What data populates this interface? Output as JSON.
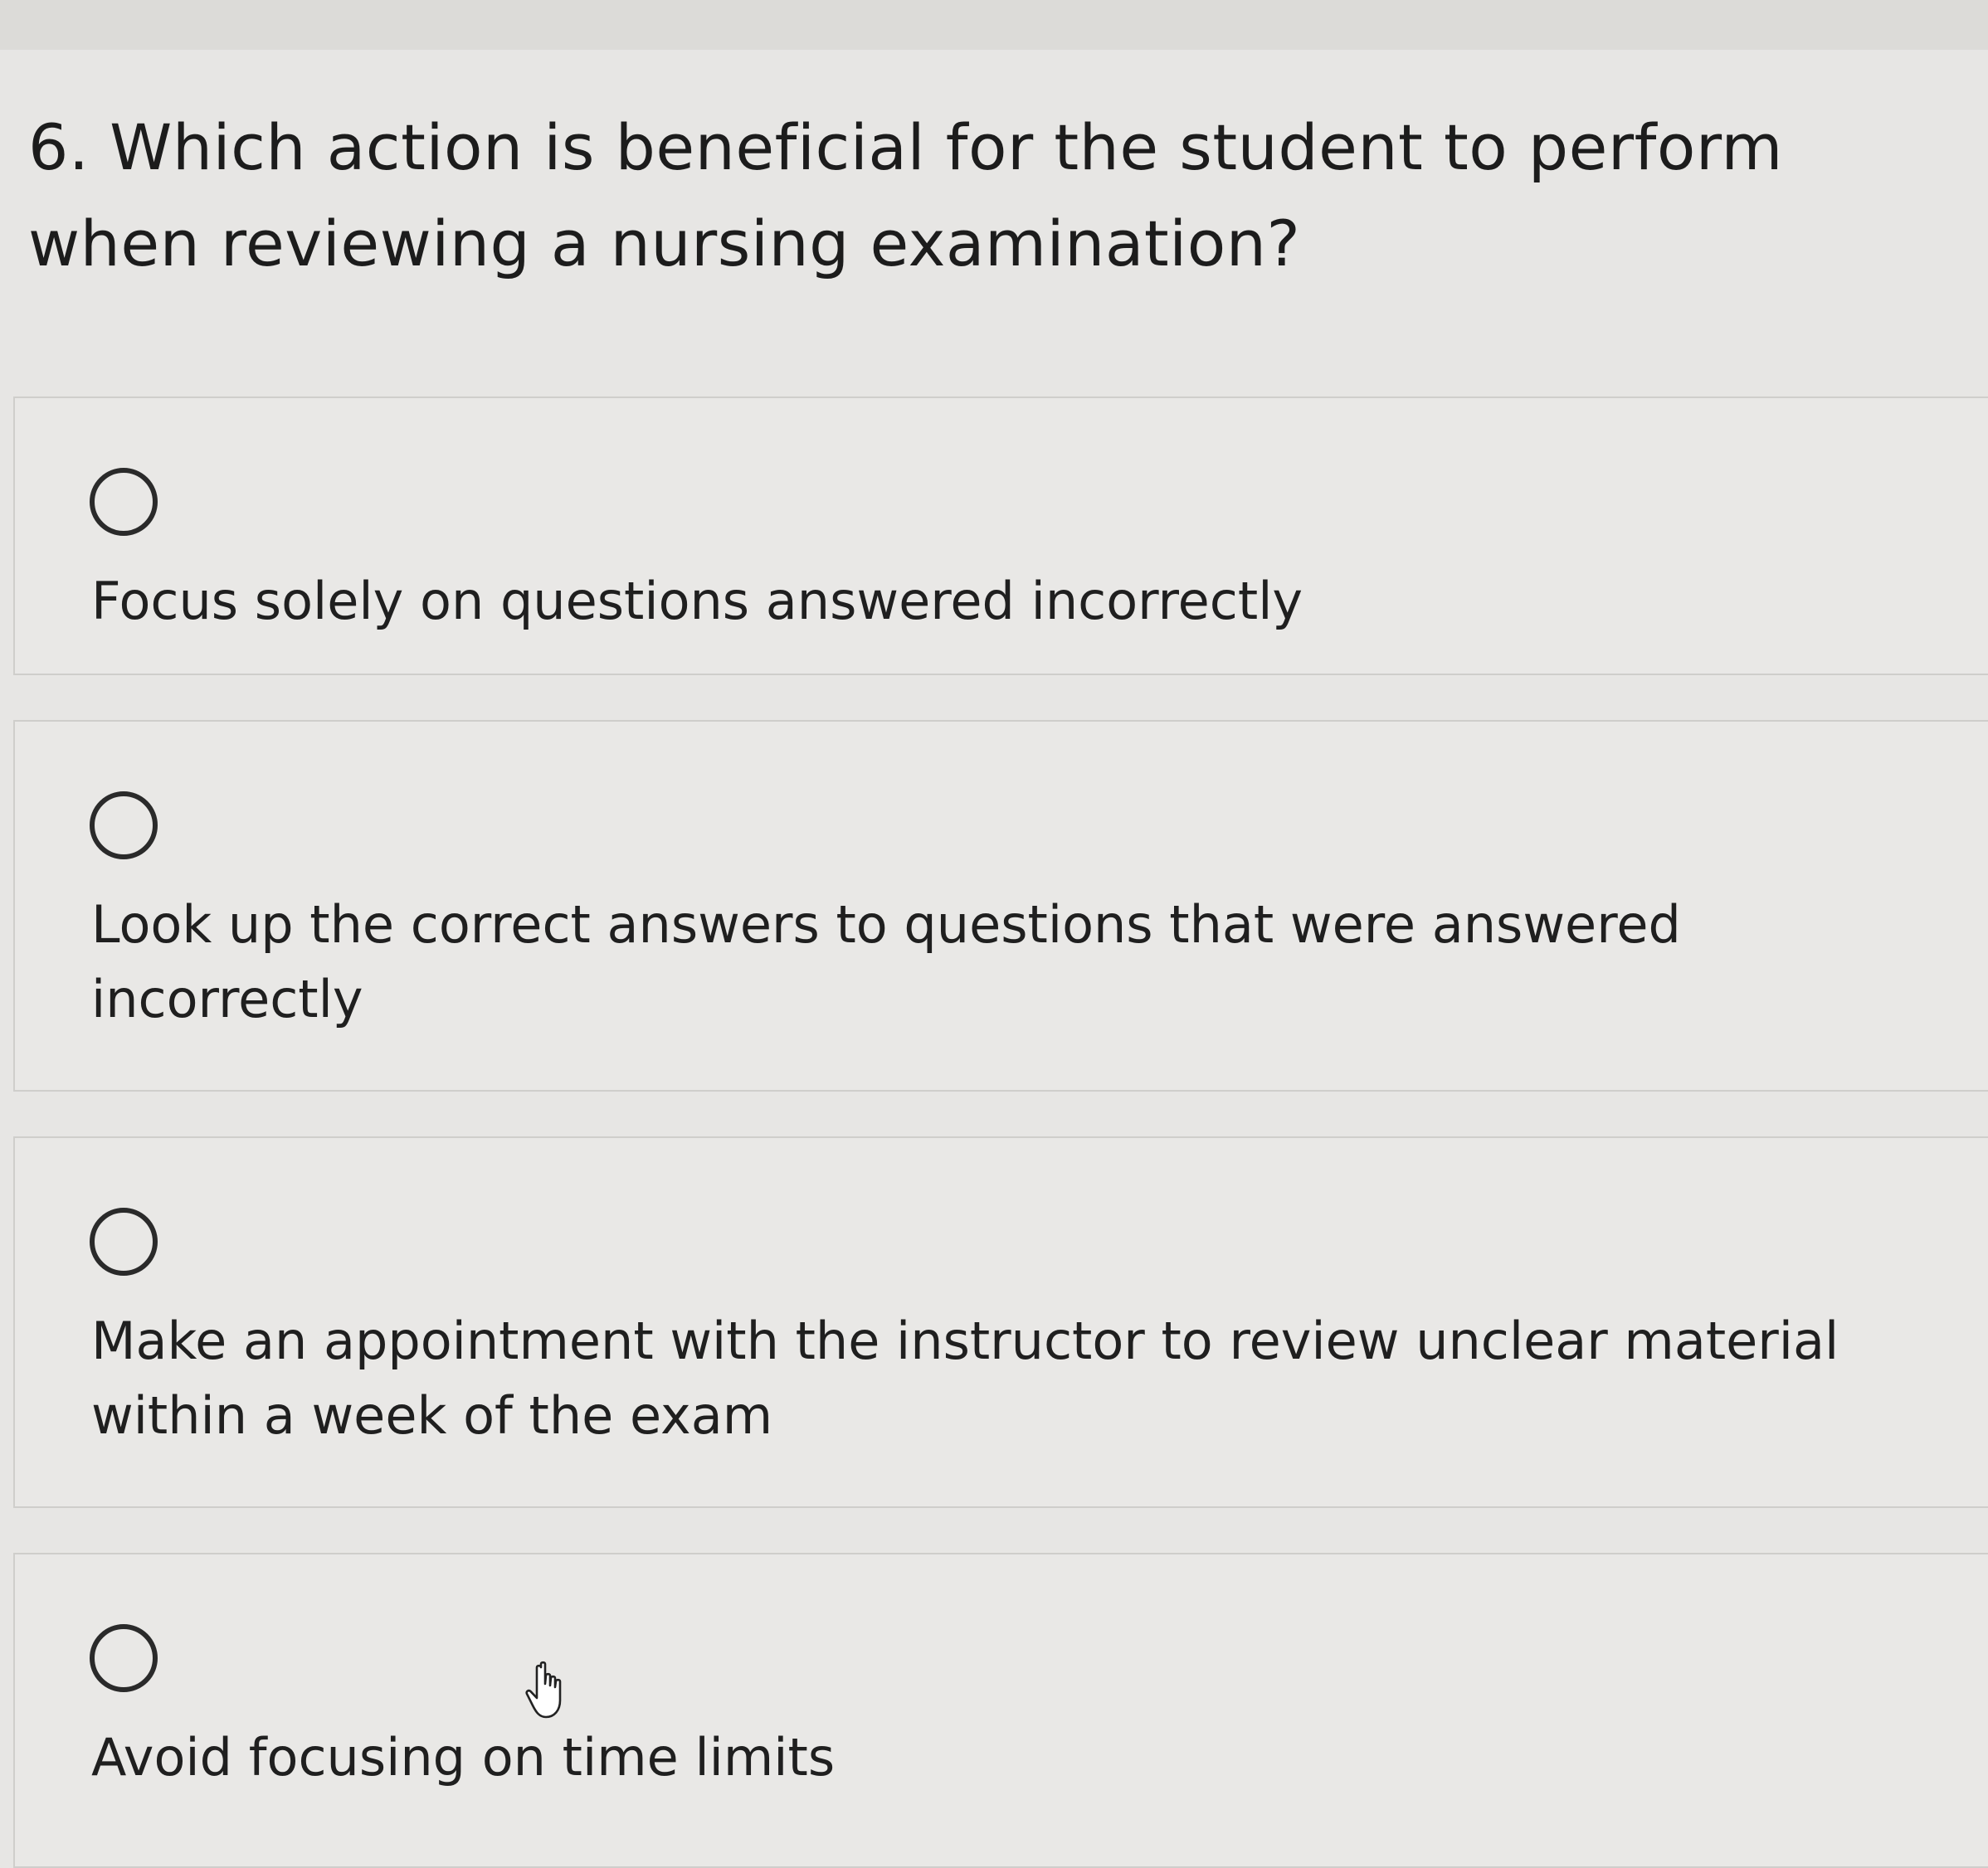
{
  "question": {
    "text": "6. Which action is beneficial for the student to perform when reviewing a nursing examination?"
  },
  "options": [
    {
      "label": "Focus solely on questions answered incorrectly",
      "selected": false
    },
    {
      "label": "Look up the correct answers to questions that were answered incorrectly",
      "selected": false
    },
    {
      "label": "Make an appointment with the instructor to review unclear material within a week of the exam",
      "selected": false
    },
    {
      "label": "Avoid focusing on time limits",
      "selected": false
    }
  ],
  "cursor": {
    "icon": "hand-pointer-icon"
  }
}
